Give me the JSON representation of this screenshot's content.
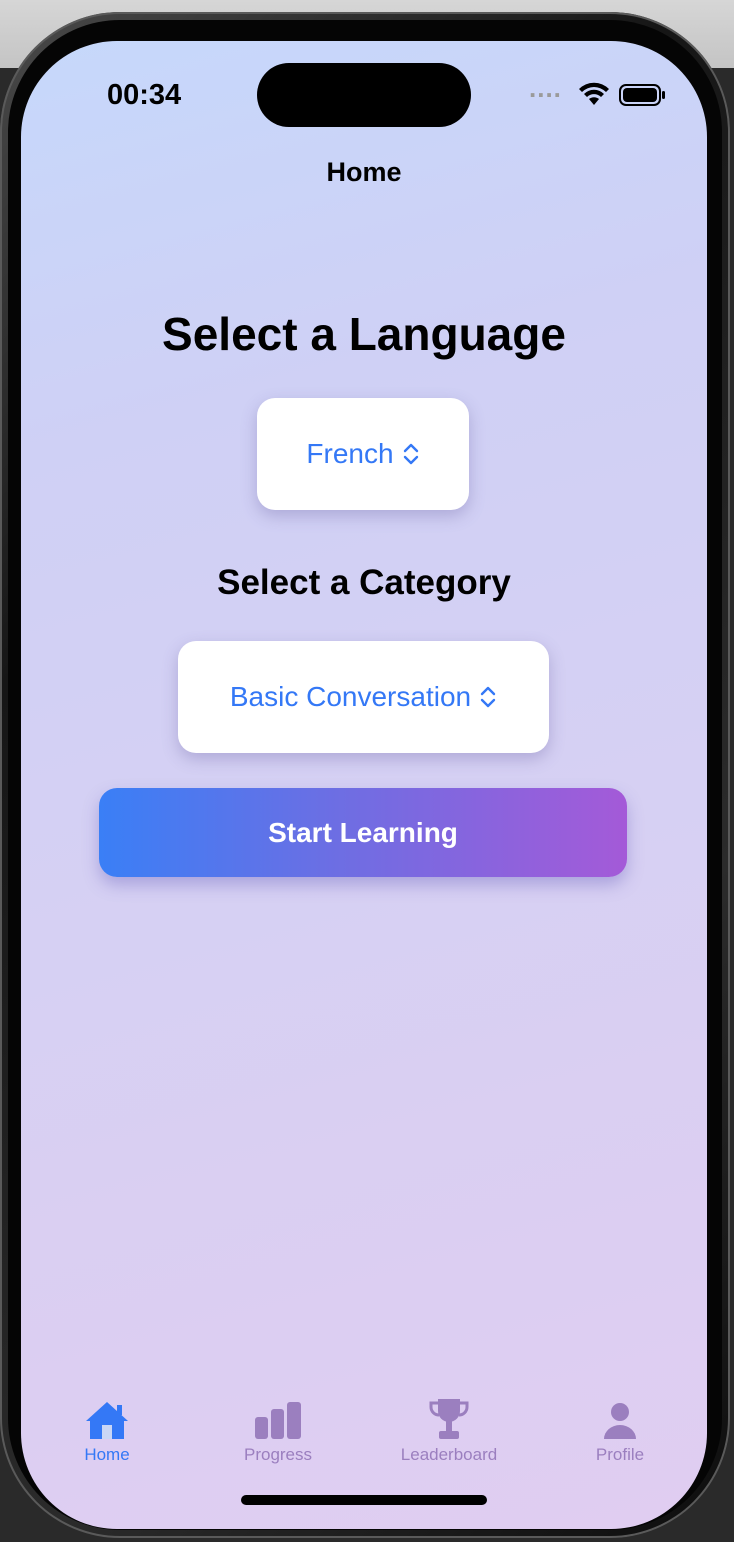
{
  "status_bar": {
    "time": "00:34",
    "signal": "....",
    "wifi_icon": "wifi-icon",
    "battery_icon": "battery-icon"
  },
  "nav": {
    "title": "Home"
  },
  "language_section": {
    "heading": "Select a Language",
    "selected": "French"
  },
  "category_section": {
    "heading": "Select a Category",
    "selected": "Basic Conversation"
  },
  "start_button": {
    "label": "Start Learning"
  },
  "tab_bar": {
    "items": [
      {
        "label": "Home",
        "icon": "house-icon",
        "active": true
      },
      {
        "label": "Progress",
        "icon": "bar-chart-icon",
        "active": false
      },
      {
        "label": "Leaderboard",
        "icon": "trophy-icon",
        "active": false
      },
      {
        "label": "Profile",
        "icon": "person-icon",
        "active": false
      }
    ]
  },
  "colors": {
    "accent": "#3478f6",
    "inactive_tab": "#9b7fbf",
    "button_gradient_start": "#3a7ff6",
    "button_gradient_end": "#a45ad8"
  }
}
